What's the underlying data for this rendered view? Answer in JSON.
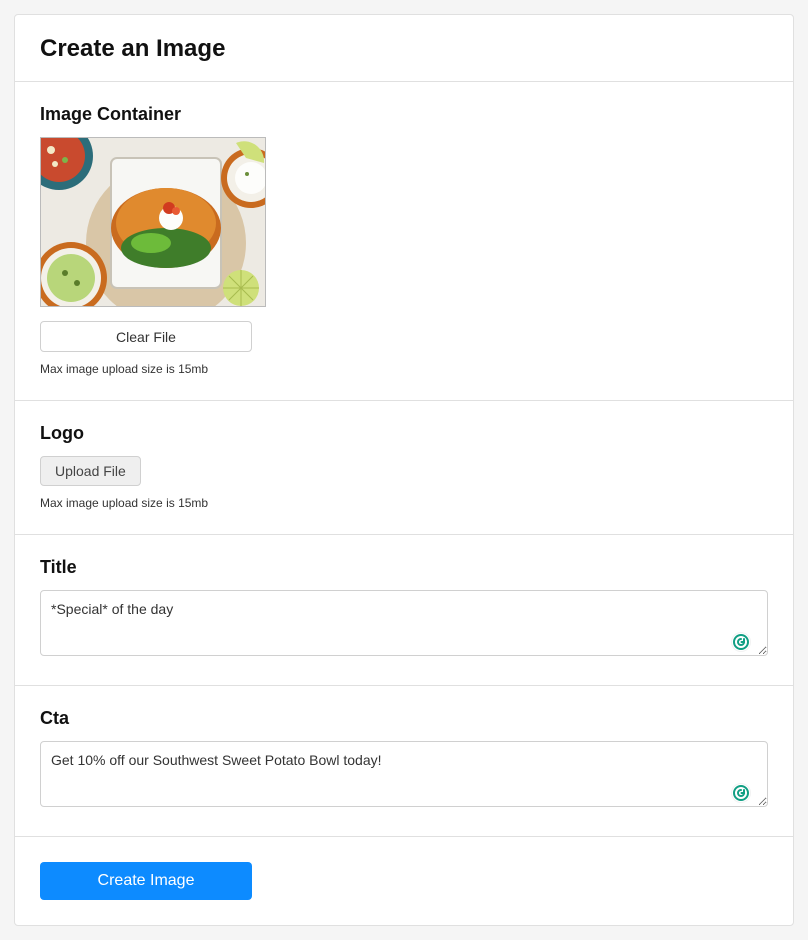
{
  "header": {
    "title": "Create an Image"
  },
  "imageContainer": {
    "label": "Image Container",
    "clearLabel": "Clear File",
    "helper": "Max image upload size is 15mb"
  },
  "logo": {
    "label": "Logo",
    "uploadLabel": "Upload File",
    "helper": "Max image upload size is 15mb"
  },
  "title": {
    "label": "Title",
    "value": "*Special* of the day"
  },
  "cta": {
    "label": "Cta",
    "value": "Get 10% off our Southwest Sweet Potato Bowl today!"
  },
  "submit": {
    "label": "Create Image"
  },
  "icons": {
    "grammarly": "grammarly-icon",
    "foodPreview": "food-photo-preview"
  }
}
